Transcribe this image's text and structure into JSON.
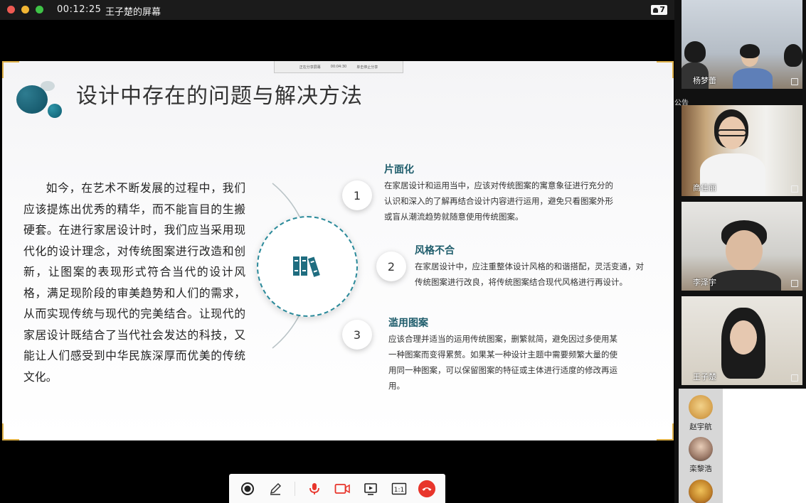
{
  "titlebar": {
    "timer": "00:12:25",
    "screen_owner": "王子楚的屏幕",
    "participant_count": "7"
  },
  "share_bar": {
    "left": "正在分享屏幕",
    "mid": "00:04:30",
    "right": "单击停止分享"
  },
  "slide": {
    "title": "设计中存在的问题与解决方法",
    "paragraph": "如今，在艺术不断发展的过程中，我们应该提炼出优秀的精华，而不能盲目的生搬硬套。在进行家居设计时，我们应当采用现代化的设计理念，对传统图案进行改造和创新，让图案的表现形式符合当代的设计风格，满足现阶段的审美趋势和人们的需求，从而实现传统与现代的完美结合。让现代的家居设计既结合了当代社会发达的科技，又能让人们感受到中华民族深厚而优美的传统文化。",
    "items": [
      {
        "number": "1",
        "title": "片面化",
        "desc": "在家居设计和运用当中，应该对传统图案的寓意象征进行充分的认识和深入的了解再结合设计内容进行运用，避免只看图案外形或盲从潮流趋势就随意使用传统图案。"
      },
      {
        "number": "2",
        "title": "风格不合",
        "desc": "在家居设计中，应注重整体设计风格的和谐搭配，灵活变通，对传统图案进行改良，将传统图案结合现代风格进行再设计。"
      },
      {
        "number": "3",
        "title": "滥用图案",
        "desc": "应该合理并适当的运用传统图案，删繁就简，避免因过多使用某一种图案而变得累赘。如果某一种设计主题中需要频繁大量的使用同一种图案，可以保留图案的特征或主体进行适度的修改再运用。"
      }
    ]
  },
  "participants": {
    "video": [
      {
        "name": "杨梦蕾"
      },
      {
        "name": "商佳丽"
      },
      {
        "name": "李泽宇"
      },
      {
        "name": "王子楚"
      }
    ],
    "notice_label": "公告",
    "audio_only": [
      {
        "name": "赵宇航"
      },
      {
        "name": "栾黎浩"
      }
    ]
  },
  "colors": {
    "accent_teal": "#1f5d6c",
    "hangup_red": "#e8352b",
    "mic_red": "#e8352b",
    "corner_gold": "#e0b24a"
  },
  "icons": {
    "toolbar": [
      "record-icon",
      "pen-icon",
      "microphone-icon",
      "camera-icon",
      "screen-share-icon",
      "original-size-icon",
      "hang-up-icon"
    ],
    "center": "books-icon"
  }
}
